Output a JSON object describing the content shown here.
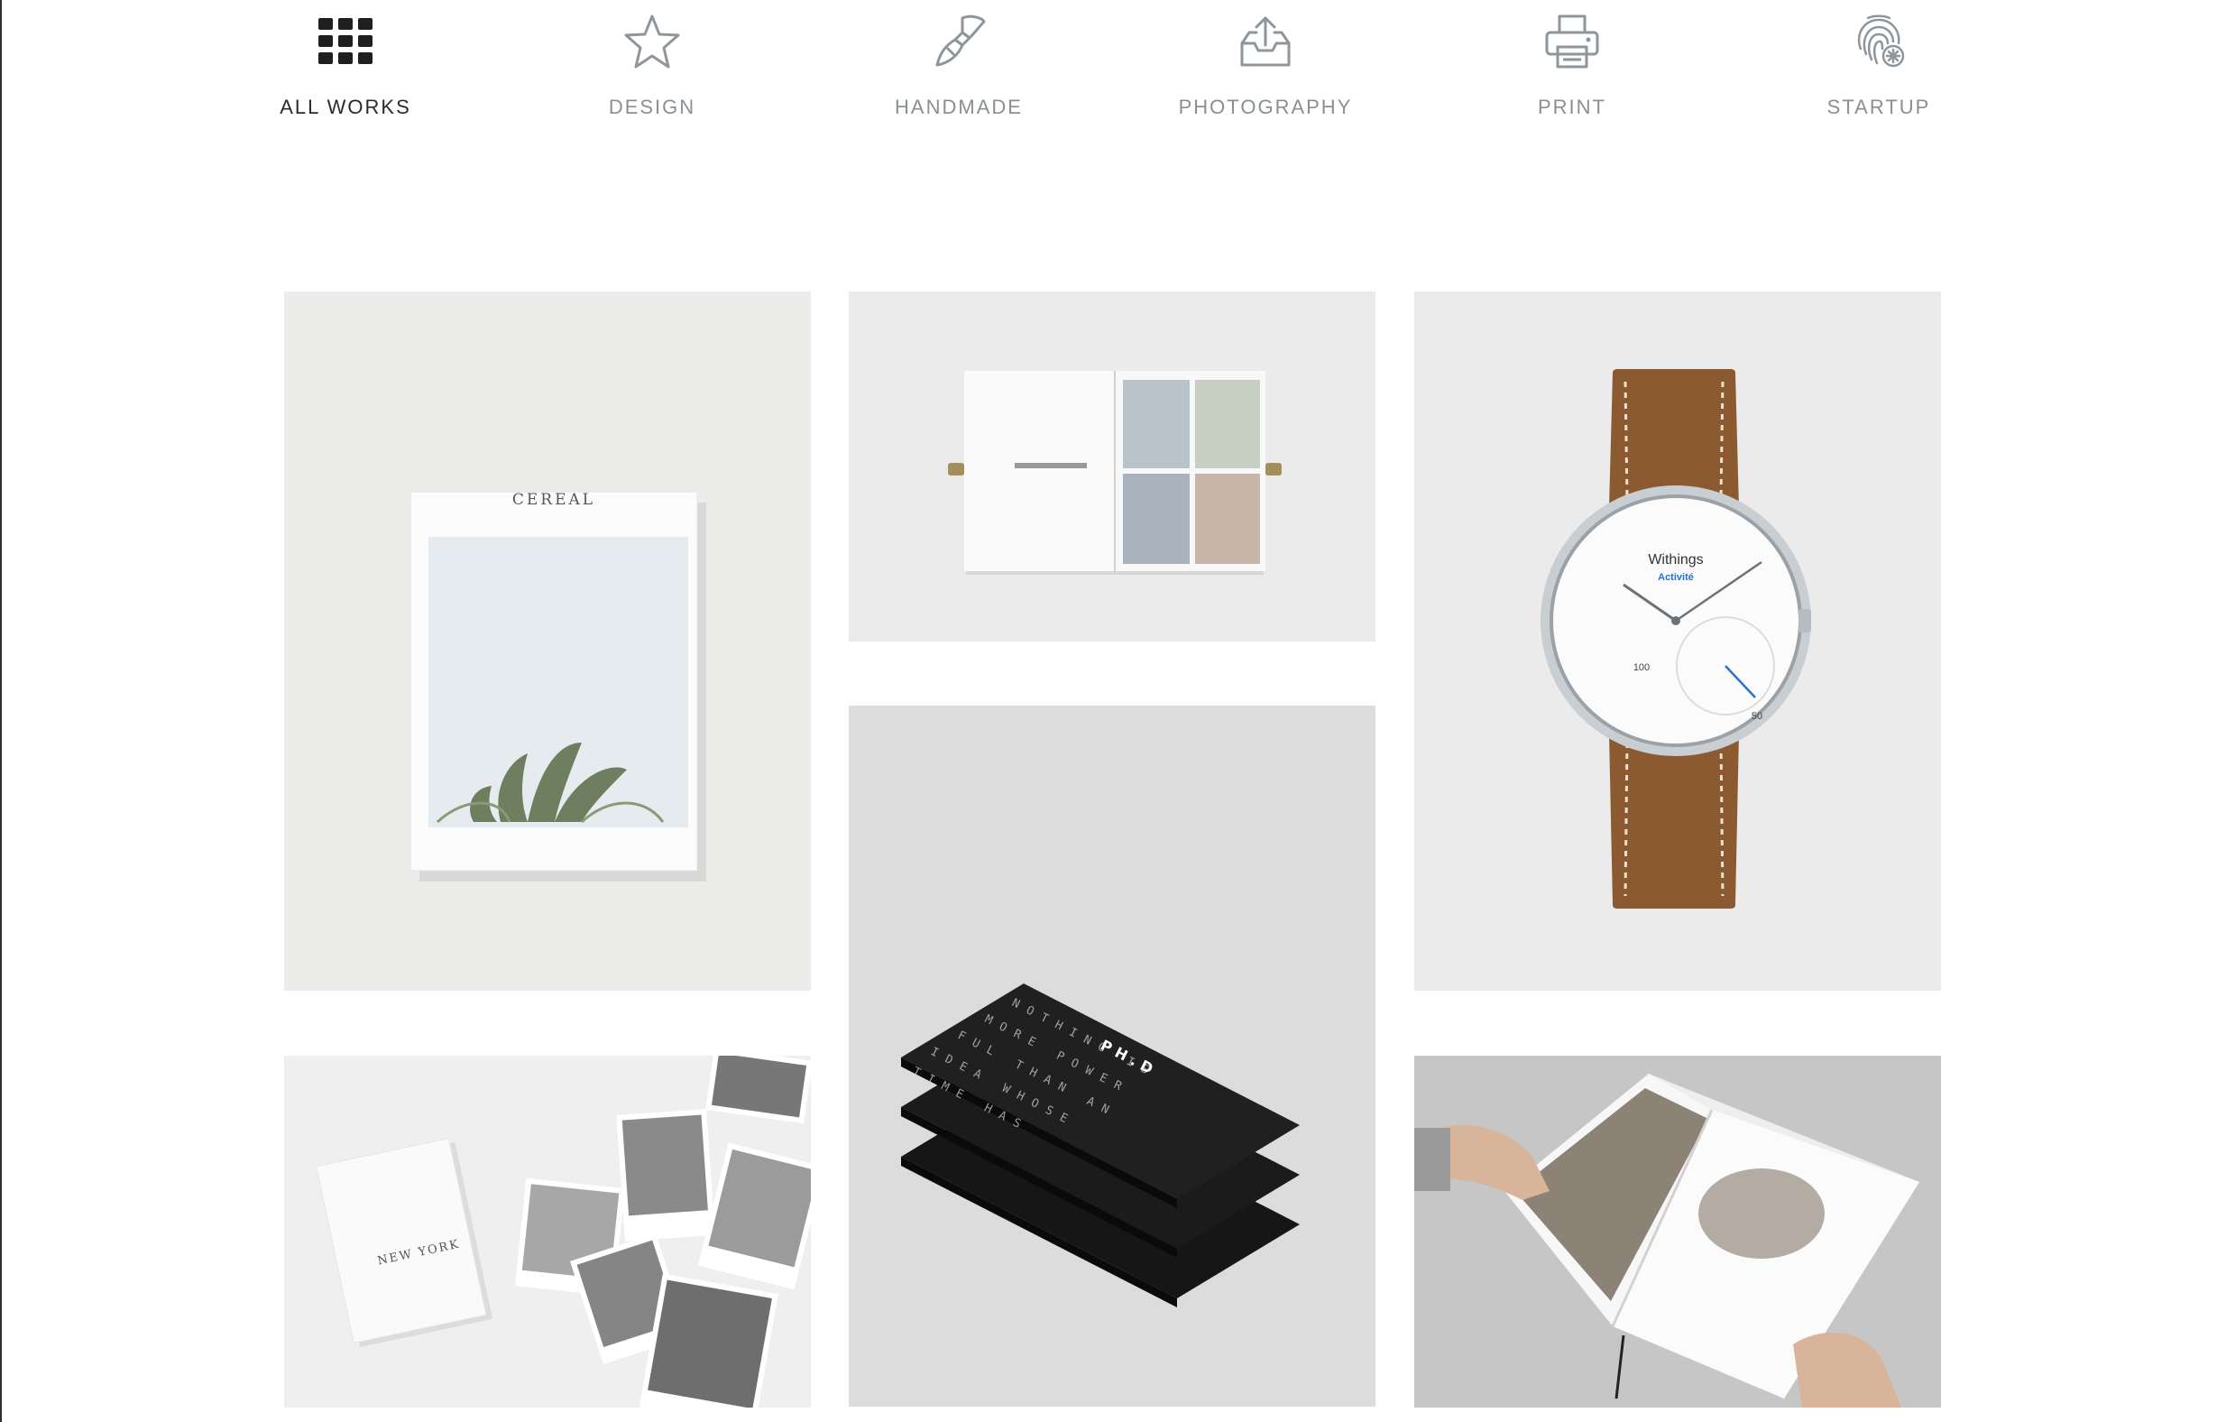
{
  "filters": [
    {
      "label": "ALL WORKS",
      "icon": "grid-icon",
      "active": true
    },
    {
      "label": "DESIGN",
      "icon": "star-icon"
    },
    {
      "label": "HANDMADE",
      "icon": "paintbrush-icon"
    },
    {
      "label": "PHOTOGRAPHY",
      "icon": "inbox-upload-icon"
    },
    {
      "label": "PRINT",
      "icon": "printer-icon"
    },
    {
      "label": "STARTUP",
      "icon": "fingerprint-icon"
    }
  ],
  "gallery": {
    "items": [
      {
        "cover_text": "CEREAL"
      },
      {},
      {
        "dial_brand": "Withings",
        "dial_model": "Activité",
        "dial_num_left": "100",
        "dial_num_right": "50"
      },
      {
        "card_text": "PH.D"
      },
      {
        "card_title": "NEW YORK"
      },
      {}
    ]
  },
  "colors": {
    "active_label": "#2b2b2b",
    "inactive_label": "#8a8f93",
    "watch_strap": "#8c5a30",
    "hand_accent": "#2a6fd6"
  }
}
